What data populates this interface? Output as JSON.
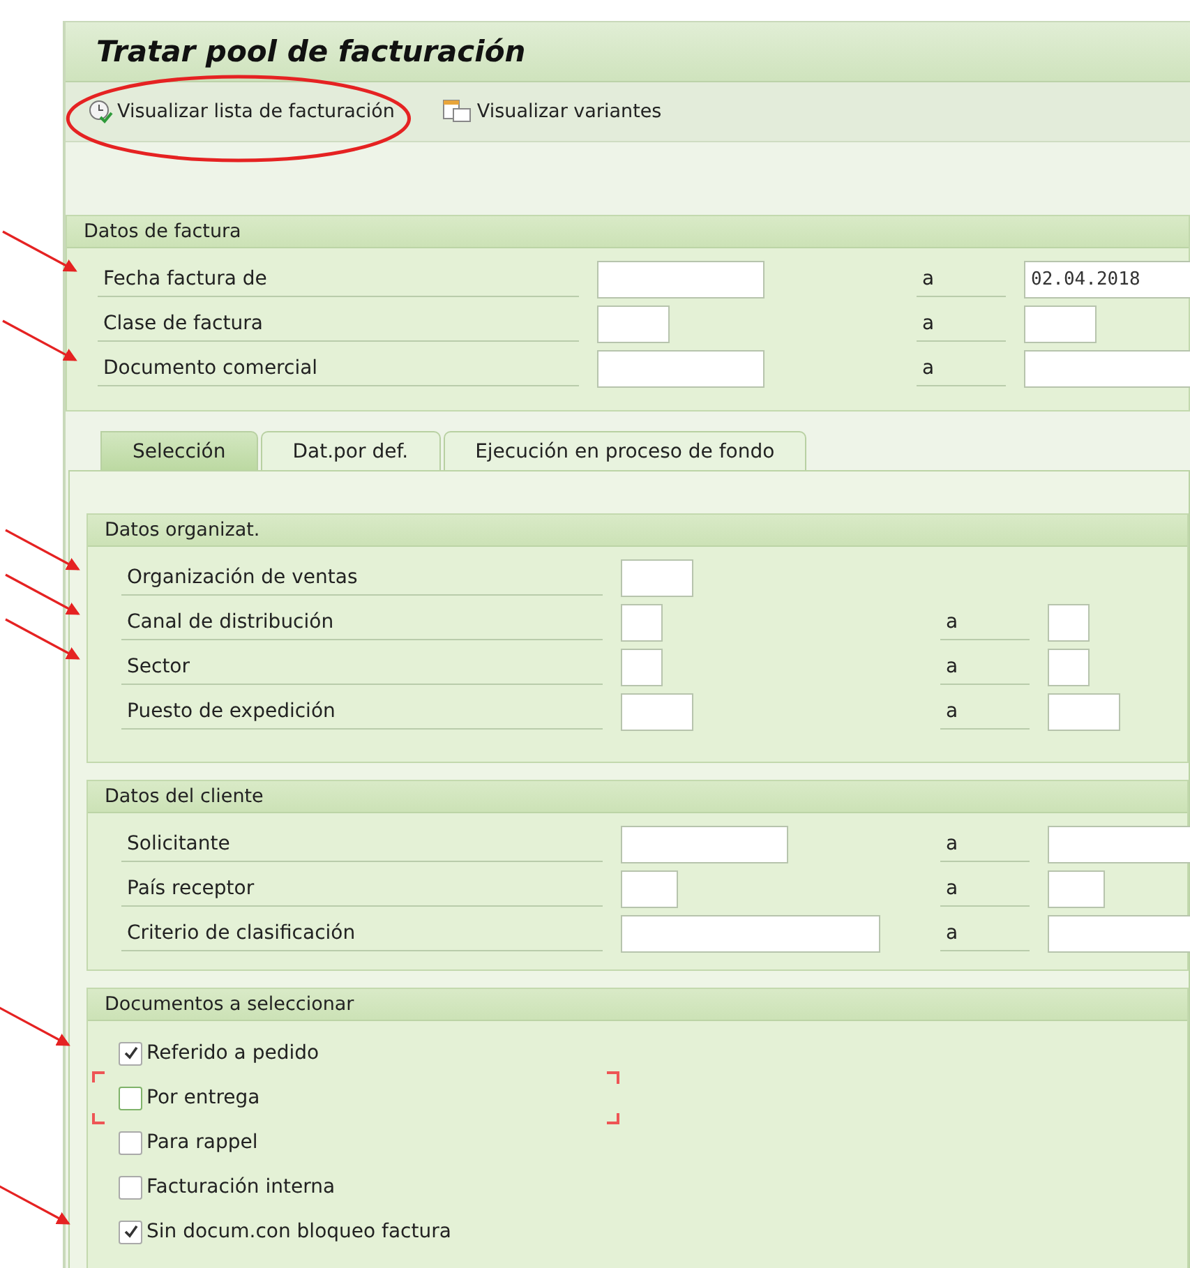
{
  "window": {
    "title": "Tratar pool de facturación"
  },
  "toolbar": {
    "buttons": [
      {
        "label": "Visualizar lista de facturación",
        "kind": "execute",
        "circled": true
      },
      {
        "label": "Visualizar variantes",
        "kind": "variants",
        "circled": false
      }
    ]
  },
  "invoice_group": {
    "title": "Datos de factura",
    "rows": [
      {
        "label": "Fecha factura de",
        "from": {
          "kind": "long"
        },
        "to_label": "a",
        "to": {
          "kind": "long",
          "value": "02.04.2018"
        },
        "arrow": true
      },
      {
        "label": "Clase de factura",
        "from": {
          "kind": "medium"
        },
        "to_label": "a",
        "to": {
          "kind": "medium"
        },
        "arrow": false
      },
      {
        "label": "Documento comercial",
        "from": {
          "kind": "long"
        },
        "to_label": "a",
        "to": {
          "kind": "long"
        },
        "arrow": true
      }
    ]
  },
  "tabs": [
    {
      "label": "Selección",
      "selected": true
    },
    {
      "label": "Dat.por def.",
      "selected": false
    },
    {
      "label": "Ejecución en proceso de fondo",
      "selected": false
    }
  ],
  "groups": [
    {
      "title": "Datos organizat.",
      "rows": [
        {
          "label": "Organización de ventas",
          "from": {
            "kind": "medium"
          },
          "arrow": true
        },
        {
          "label": "Canal de distribución",
          "from": {
            "kind": "tiny"
          },
          "to_label": "a",
          "to": {
            "kind": "tiny"
          },
          "arrow": true
        },
        {
          "label": "Sector",
          "from": {
            "kind": "tiny"
          },
          "to_label": "a",
          "to": {
            "kind": "tiny"
          },
          "arrow": true
        },
        {
          "label": "Puesto de expedición",
          "from": {
            "kind": "medium"
          },
          "to_label": "a",
          "to": {
            "kind": "medium"
          },
          "arrow": false
        }
      ]
    },
    {
      "title": "Datos del cliente",
      "rows": [
        {
          "label": "Solicitante",
          "from": {
            "kind": "long"
          },
          "to_label": "a",
          "to": {
            "kind": "long"
          },
          "arrow": false
        },
        {
          "label": "País receptor",
          "from": {
            "kind": "small"
          },
          "to_label": "a",
          "to": {
            "kind": "small"
          },
          "arrow": false
        },
        {
          "label": "Criterio de clasificación",
          "from": {
            "kind": "wide"
          },
          "to_label": "a",
          "to": {
            "kind": "wide"
          },
          "arrow": false
        }
      ]
    }
  ],
  "documents": {
    "title": "Documentos a seleccionar",
    "options": [
      {
        "label": "Referido a pedido",
        "checked": true,
        "focused": false,
        "arrow": true
      },
      {
        "label": "Por entrega",
        "checked": false,
        "focused": true,
        "arrow": false
      },
      {
        "label": "Para rappel",
        "checked": false,
        "focused": false,
        "arrow": false
      },
      {
        "label": "Facturación interna",
        "checked": false,
        "focused": false,
        "arrow": false
      },
      {
        "label": "Sin docum.con bloqueo factura",
        "checked": true,
        "focused": false,
        "arrow": true
      }
    ]
  }
}
